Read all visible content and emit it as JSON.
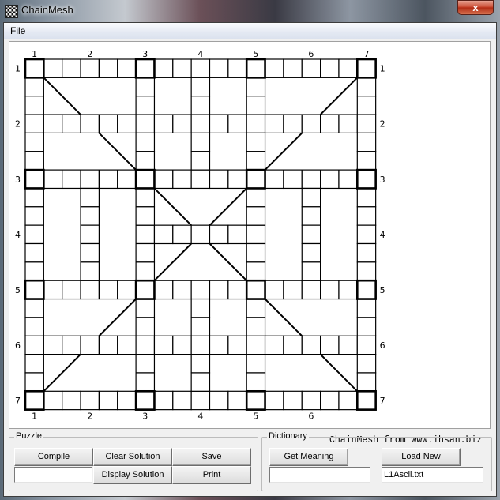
{
  "window": {
    "title": "ChainMesh",
    "close_label": "x"
  },
  "menu": {
    "items": [
      {
        "label": "File"
      }
    ]
  },
  "board": {
    "credit": "ChainMesh from www.ihsan.biz",
    "size_cells": 19,
    "col_labels": [
      "1",
      "2",
      "3",
      "4",
      "5",
      "6",
      "7"
    ],
    "row_labels": [
      "1",
      "2",
      "3",
      "4",
      "5",
      "6",
      "7"
    ],
    "label_cell_indices": [
      0,
      3,
      6,
      9,
      12,
      15,
      18
    ],
    "node_indices": [
      0,
      6,
      12,
      18
    ],
    "horizontal_runs": [
      {
        "row": 0,
        "from": 0,
        "to": 18
      },
      {
        "row": 3,
        "from": 0,
        "to": 18
      },
      {
        "row": 6,
        "from": 0,
        "to": 18
      },
      {
        "row": 9,
        "from": 6,
        "to": 12
      },
      {
        "row": 12,
        "from": 0,
        "to": 18
      },
      {
        "row": 15,
        "from": 0,
        "to": 18
      },
      {
        "row": 18,
        "from": 0,
        "to": 18
      }
    ],
    "vertical_runs": [
      {
        "col": 0,
        "from": 0,
        "to": 18
      },
      {
        "col": 6,
        "from": 0,
        "to": 18
      },
      {
        "col": 12,
        "from": 0,
        "to": 18
      },
      {
        "col": 18,
        "from": 0,
        "to": 18
      },
      {
        "col": 9,
        "from": 0,
        "to": 6
      },
      {
        "col": 9,
        "from": 12,
        "to": 18
      },
      {
        "col": 3,
        "from": 6,
        "to": 12
      },
      {
        "col": 15,
        "from": 6,
        "to": 12
      }
    ],
    "diagonals": [
      [
        1,
        1,
        3,
        3
      ],
      [
        4,
        4,
        6,
        6
      ],
      [
        18,
        1,
        16,
        3
      ],
      [
        15,
        4,
        13,
        6
      ],
      [
        7,
        7,
        9,
        9
      ],
      [
        12,
        7,
        10,
        9
      ],
      [
        7,
        12,
        9,
        10
      ],
      [
        12,
        12,
        10,
        10
      ],
      [
        6,
        13,
        4,
        15
      ],
      [
        3,
        16,
        1,
        18
      ],
      [
        13,
        13,
        15,
        15
      ],
      [
        16,
        16,
        18,
        18
      ]
    ]
  },
  "puzzle": {
    "legend": "Puzzle",
    "compile_label": "Compile",
    "clear_solution_label": "Clear Solution",
    "save_label": "Save",
    "display_solution_label": "Display Solution",
    "print_label": "Print",
    "input_value": ""
  },
  "dictionary": {
    "legend": "Dictionary",
    "get_meaning_label": "Get Meaning",
    "load_new_label": "Load New",
    "word_input_value": "",
    "file_input_value": "L1Ascii.txt"
  }
}
